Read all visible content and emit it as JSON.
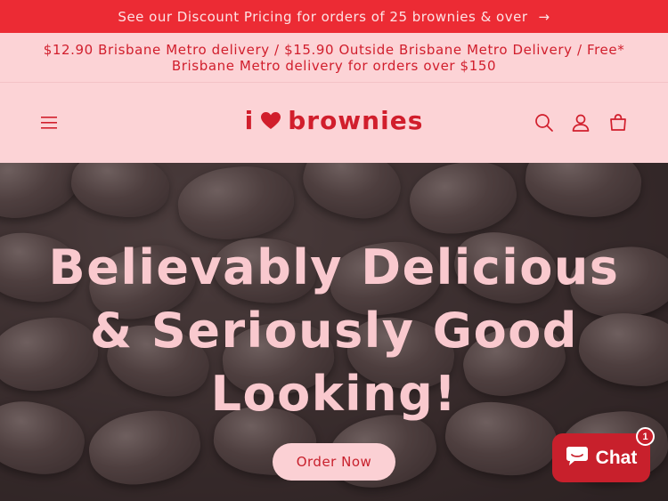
{
  "announcement": {
    "text": "See our Discount Pricing for orders of 25 brownies & over",
    "arrow": "→"
  },
  "delivery_banner": {
    "text": "$12.90 Brisbane Metro delivery / $15.90 Outside Brisbane Metro Delivery / Free* Brisbane Metro delivery for orders over $150"
  },
  "header": {
    "logo_left": "i",
    "logo_right": "brownies",
    "icons": [
      "hamburger-menu-icon",
      "search-icon",
      "account-icon",
      "cart-icon"
    ]
  },
  "hero": {
    "title": "Believably Delicious & Seriously Good Looking!",
    "cta_label": "Order Now"
  },
  "chat": {
    "label": "Chat",
    "badge_count": "1"
  },
  "colors": {
    "announce_bg": "#ec2b34",
    "page_bg": "#fcd3d6",
    "brand_red": "#d11e2c",
    "hero_text": "#f9c9ce",
    "chat_bg": "#c8202c"
  }
}
